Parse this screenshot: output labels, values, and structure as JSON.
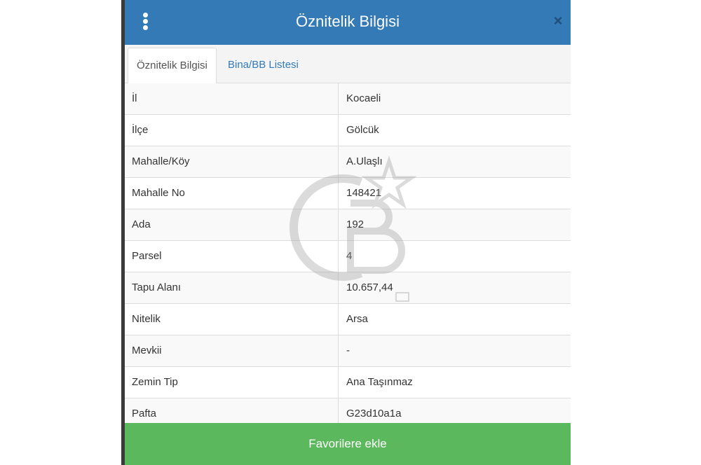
{
  "header": {
    "title": "Öznitelik Bilgisi"
  },
  "tabs": [
    {
      "label": "Öznitelik Bilgisi",
      "active": true
    },
    {
      "label": "Bina/BB Listesi",
      "active": false
    }
  ],
  "rows": [
    {
      "label": "İl",
      "value": "Kocaeli"
    },
    {
      "label": "İlçe",
      "value": "Gölcük"
    },
    {
      "label": "Mahalle/Köy",
      "value": "A.Ulaşlı"
    },
    {
      "label": "Mahalle No",
      "value": "148421"
    },
    {
      "label": "Ada",
      "value": "192"
    },
    {
      "label": "Parsel",
      "value": "4"
    },
    {
      "label": "Tapu Alanı",
      "value": "10.657,44"
    },
    {
      "label": "Nitelik",
      "value": "Arsa"
    },
    {
      "label": "Mevkii",
      "value": "-"
    },
    {
      "label": "Zemin Tip",
      "value": "Ana Taşınmaz"
    },
    {
      "label": "Pafta",
      "value": "G23d10a1a"
    }
  ],
  "footer": {
    "favorite_label": "Favorilere ekle"
  },
  "colors": {
    "header": "#337ab7",
    "button": "#5cb85c",
    "link": "#337ab7"
  },
  "icons": {
    "menu": "vertical-dots-icon",
    "close": "close-icon",
    "watermark": "cb-logo-watermark"
  }
}
